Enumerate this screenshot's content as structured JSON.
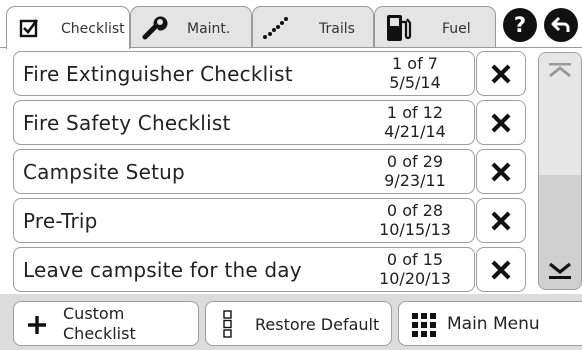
{
  "tabs": [
    {
      "id": "checklist",
      "label": "Checklist",
      "icon": "checkbox-icon"
    },
    {
      "id": "maint",
      "label": "Maint.",
      "icon": "wrench-icon"
    },
    {
      "id": "trails",
      "label": "Trails",
      "icon": "trail-dots-icon"
    },
    {
      "id": "fuel",
      "label": "Fuel",
      "icon": "fuel-pump-icon"
    }
  ],
  "header": {
    "help_glyph": "?",
    "help_icon": "help-icon",
    "back_icon": "back-arrow-icon"
  },
  "checklists": [
    {
      "title": "Fire Extinguisher Checklist",
      "progress": "1 of 7",
      "date": "5/5/14"
    },
    {
      "title": "Fire Safety Checklist",
      "progress": "1 of 12",
      "date": "4/21/14"
    },
    {
      "title": "Campsite Setup",
      "progress": "0 of 29",
      "date": "9/23/11"
    },
    {
      "title": "Pre-Trip",
      "progress": "0 of 28",
      "date": "10/15/13"
    },
    {
      "title": "Leave campsite for the day",
      "progress": "0 of 15",
      "date": "10/20/13"
    }
  ],
  "footer": {
    "custom_line1": "Custom",
    "custom_line2": "Checklist",
    "restore": "Restore Default",
    "main_menu": "Main Menu"
  },
  "colors": {
    "accent": "#111111",
    "tab_inactive": "#e4e4e4",
    "footer_bg": "#dcdcdc"
  }
}
